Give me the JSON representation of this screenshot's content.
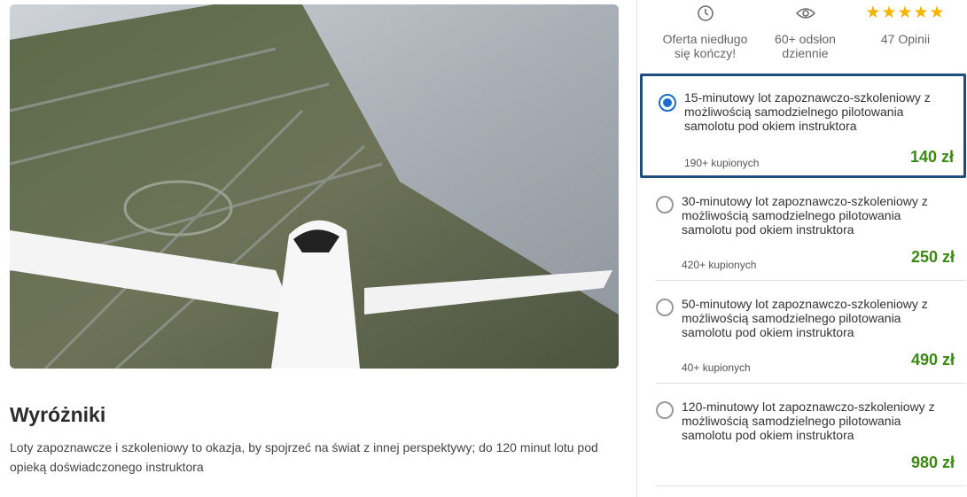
{
  "hero": {
    "icon": "airplane-photo"
  },
  "highlights": {
    "title": "Wyróżniki",
    "text": "Loty zapoznawcze i szkoleniowy to okazja, by spojrzeć na świat z innej perspektywy; do 120 minut lotu pod opieką doświadczonego instruktora"
  },
  "stats": {
    "ending": {
      "icon": "clock-icon",
      "line1": "Oferta niedługo",
      "line2": "się kończy!"
    },
    "views": {
      "icon": "eye-icon",
      "line1": "60+ odsłon",
      "line2": "dziennie"
    },
    "reviews": {
      "stars": "★★★★★",
      "label": "47 Opinii",
      "rating": 5
    }
  },
  "options": [
    {
      "title": "15-minutowy lot zapoznawczo-szkoleniowy z możliwością samodzielnego pilotowania samolotu pod okiem instruktora",
      "count": "190+ kupionych",
      "price": "140 zł",
      "selected": true
    },
    {
      "title": "30-minutowy lot zapoznawczo-szkoleniowy z możliwością samodzielnego pilotowania samolotu pod okiem instruktora",
      "count": "420+ kupionych",
      "price": "250 zł",
      "selected": false
    },
    {
      "title": "50-minutowy lot zapoznawczo-szkoleniowy z możliwością samodzielnego pilotowania samolotu pod okiem instruktora",
      "count": "40+ kupionych",
      "price": "490 zł",
      "selected": false
    },
    {
      "title": "120-minutowy lot zapoznawczo-szkoleniowy z możliwością samodzielnego pilotowania samolotu pod okiem instruktora",
      "count": "",
      "price": "980 zł",
      "selected": false
    }
  ],
  "colors": {
    "accent": "#1f4d7a",
    "radio": "#1a6dc9",
    "price": "#3a8a12",
    "stars": "#f5b400"
  }
}
